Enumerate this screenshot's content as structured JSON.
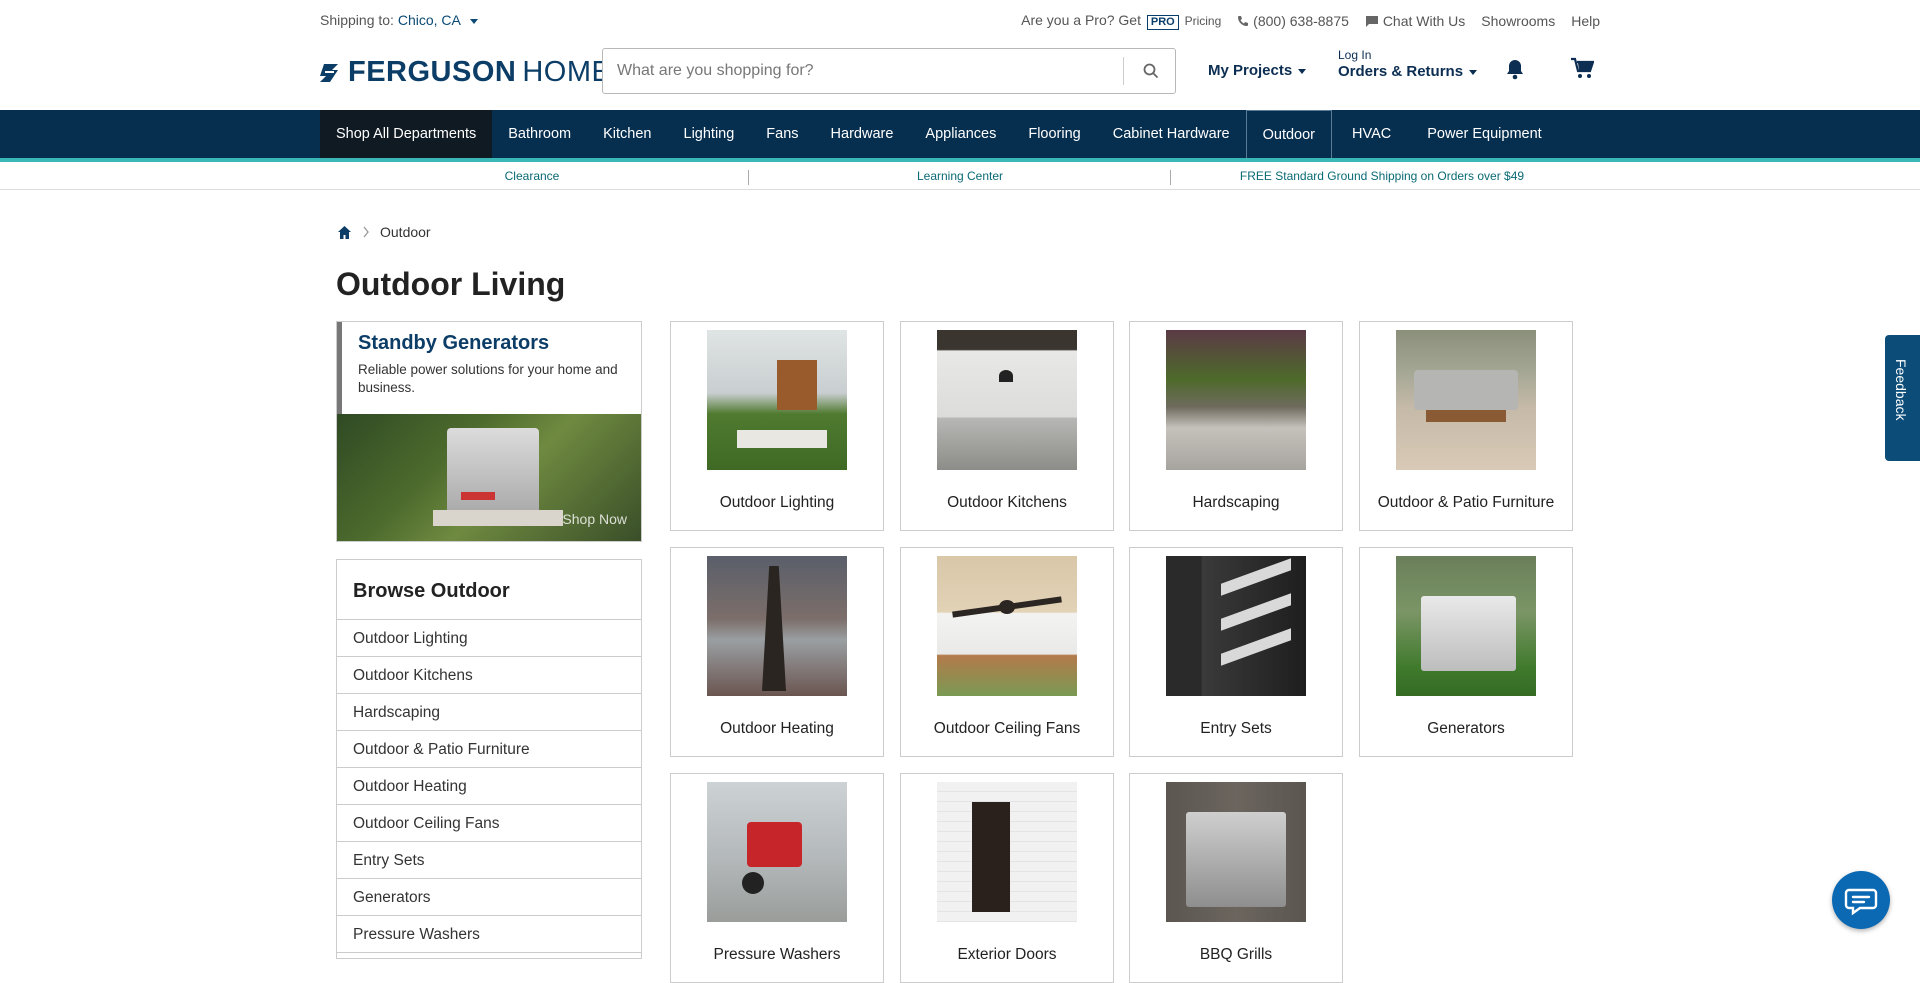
{
  "utility": {
    "ship_label": "Shipping to:",
    "ship_location": "Chico, CA",
    "pro_question": "Are you a Pro? Get",
    "pro_badge": "PRO",
    "pro_pricing": "Pricing",
    "phone": "(800) 638-8875",
    "chat": "Chat With Us",
    "showrooms": "Showrooms",
    "help": "Help"
  },
  "header": {
    "logo_brand": "FERGUSON",
    "logo_home": "HOME",
    "search_placeholder": "What are you shopping for?",
    "my_projects": "My Projects",
    "log_in": "Log In",
    "orders_returns": "Orders & Returns"
  },
  "nav": {
    "items": [
      "Shop All Departments",
      "Bathroom",
      "Kitchen",
      "Lighting",
      "Fans",
      "Hardware",
      "Appliances",
      "Flooring",
      "Cabinet Hardware",
      "Outdoor",
      "HVAC",
      "Power Equipment"
    ],
    "active": "Outdoor"
  },
  "promo_bar": {
    "items": [
      "Clearance",
      "Learning Center",
      "FREE Standard Ground Shipping on Orders over $49"
    ]
  },
  "breadcrumb": {
    "current": "Outdoor"
  },
  "page": {
    "title": "Outdoor Living"
  },
  "promo_card": {
    "title": "Standby Generators",
    "text": "Reliable power solutions for your home and business.",
    "cta": "Shop Now"
  },
  "browse": {
    "title": "Browse Outdoor",
    "items": [
      "Outdoor Lighting",
      "Outdoor Kitchens",
      "Hardscaping",
      "Outdoor & Patio Furniture",
      "Outdoor Heating",
      "Outdoor Ceiling Fans",
      "Entry Sets",
      "Generators",
      "Pressure Washers"
    ]
  },
  "tiles": [
    {
      "label": "Outdoor Lighting"
    },
    {
      "label": "Outdoor Kitchens"
    },
    {
      "label": "Hardscaping"
    },
    {
      "label": "Outdoor & Patio Furniture"
    },
    {
      "label": "Outdoor Heating"
    },
    {
      "label": "Outdoor Ceiling Fans"
    },
    {
      "label": "Entry Sets"
    },
    {
      "label": "Generators"
    },
    {
      "label": "Pressure Washers"
    },
    {
      "label": "Exterior Doors"
    },
    {
      "label": "BBQ Grills"
    }
  ],
  "side": {
    "feedback": "Feedback"
  },
  "colors": {
    "brand": "#0c3d66",
    "nav_bg": "#062e4f",
    "nav_accent": "#3ab7b7",
    "link": "#0a6a75"
  }
}
